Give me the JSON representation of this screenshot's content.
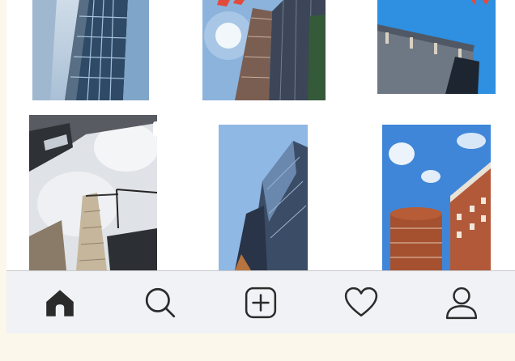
{
  "feed": {
    "photos": [
      {
        "id": "p1",
        "subject": "glass-facade-building"
      },
      {
        "id": "p2",
        "subject": "tower-with-sun-flare"
      },
      {
        "id": "p3",
        "subject": "concrete-balconies-blue-sky"
      },
      {
        "id": "p4",
        "subject": "towers-from-below-with-crane",
        "multi": true
      },
      {
        "id": "p5",
        "subject": "angular-glass-tower"
      },
      {
        "id": "p6",
        "subject": "brick-round-towers"
      }
    ]
  },
  "tabbar": {
    "tabs": [
      {
        "name": "home",
        "icon": "home-icon",
        "active": true
      },
      {
        "name": "search",
        "icon": "search-icon"
      },
      {
        "name": "create",
        "icon": "plus-square-icon"
      },
      {
        "name": "activity",
        "icon": "heart-icon"
      },
      {
        "name": "profile",
        "icon": "person-icon"
      }
    ]
  },
  "colors": {
    "page_background": "#fbf7ea",
    "tabbar_background": "#f1f2f5",
    "icon": "#2b2b2b",
    "sky": "#4a8fd6"
  }
}
